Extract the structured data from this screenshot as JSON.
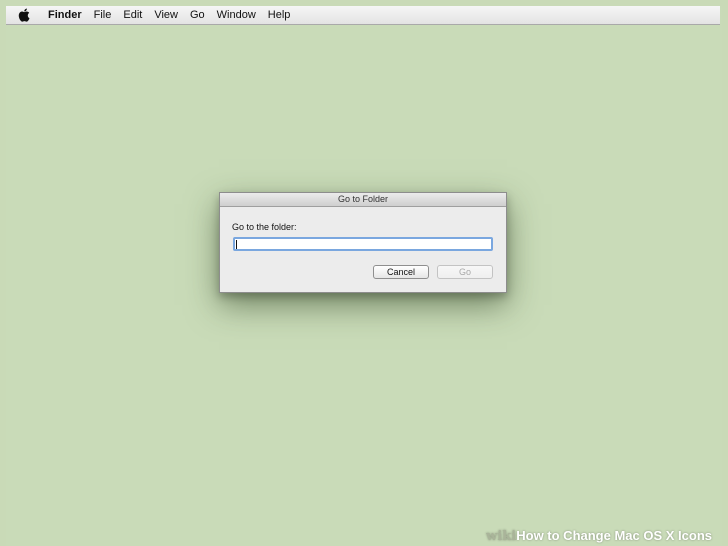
{
  "menubar": {
    "apple_icon": "apple-logo-icon",
    "items": [
      "Finder",
      "File",
      "Edit",
      "View",
      "Go",
      "Window",
      "Help"
    ]
  },
  "dialog": {
    "title": "Go to Folder",
    "prompt": "Go to the folder:",
    "input_value": "",
    "cancel_label": "Cancel",
    "go_label": "Go"
  },
  "watermark": {
    "brand": "wiki",
    "text": "How to Change Mac OS X Icons"
  },
  "colors": {
    "desktop": "#c9dab7",
    "input_focus": "#7aa7df"
  }
}
